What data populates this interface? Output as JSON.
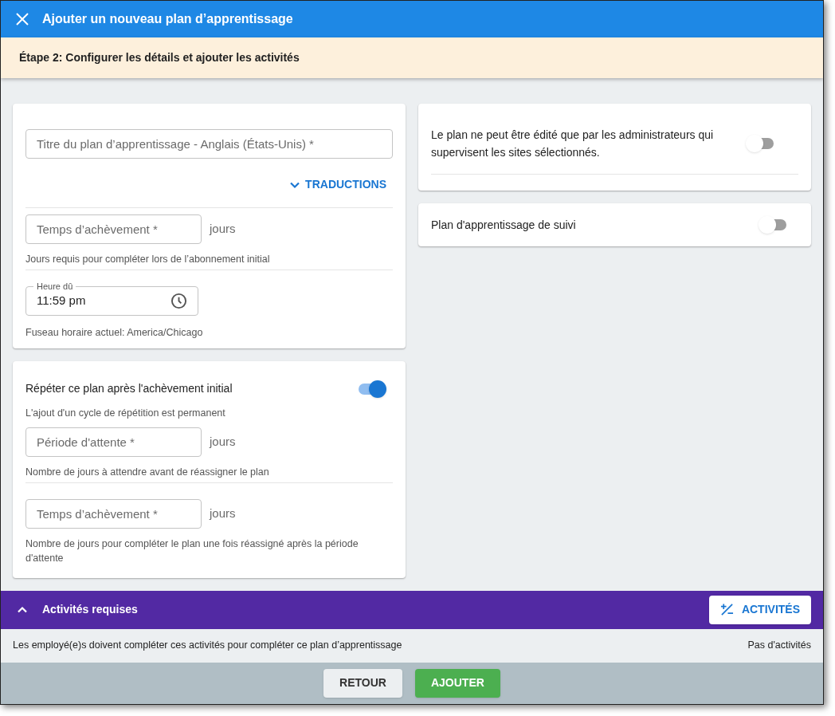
{
  "window": {
    "title": "Ajouter un nouveau plan d’apprentissage"
  },
  "step_banner": {
    "text": "Étape 2: Configurer les détails et ajouter les activités"
  },
  "details_card": {
    "title_field": {
      "placeholder": "Titre du plan d’apprentissage - Anglais (États-Unis) *"
    },
    "translations_button": {
      "label": "TRADUCTIONS",
      "expanded": false
    },
    "completion_field": {
      "placeholder": "Temps d’achèvement *",
      "unit": "jours",
      "hint": "Jours requis pour compléter lors de l’abonnement initial"
    },
    "due_time_field": {
      "label": "Heure dû",
      "value": "11:59 pm",
      "hint": "Fuseau horaire actuel: America/Chicago"
    }
  },
  "repeat_card": {
    "label": "Répéter ce plan après l'achèvement initial",
    "on": true,
    "note": "L'ajout d'un cycle de répétition est permanent",
    "fields": [
      {
        "placeholder": "Période d'attente *",
        "unit": "jours",
        "hint": "Nombre de jours à attendre avant de réassigner le plan"
      },
      {
        "placeholder": "Temps d’achèvement *",
        "unit": "jours",
        "hint": "Nombre de jours pour compléter le plan une fois réassigné après la période d'attente"
      }
    ]
  },
  "right_cards": [
    {
      "label": "Le plan ne peut être édité que par les administrateurs qui supervisent les sites sélectionnés.",
      "on": false
    },
    {
      "label": "Plan d'apprentissage de suivi",
      "on": false
    }
  ],
  "activities_section": {
    "title": "Activités requises",
    "expanded": true,
    "button": "ACTIVITÉS",
    "description": "Les employé(e)s doivent compléter ces activités pour compléter ce plan d’apprentissage",
    "count": "Pas d'activités"
  },
  "footer": {
    "buttons": [
      {
        "label": "RETOUR",
        "kind": "secondary"
      },
      {
        "label": "AJOUTER",
        "kind": "primary"
      }
    ]
  }
}
